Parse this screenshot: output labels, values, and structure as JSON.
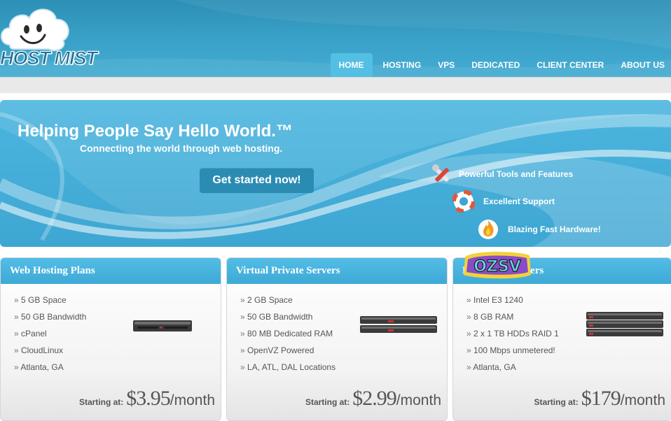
{
  "brand": {
    "logo_text": "HOST MIST"
  },
  "nav": {
    "items": [
      {
        "label": "HOME",
        "active": true
      },
      {
        "label": "HOSTING"
      },
      {
        "label": "VPS"
      },
      {
        "label": "DEDICATED"
      },
      {
        "label": "CLIENT CENTER"
      },
      {
        "label": "ABOUT US"
      }
    ]
  },
  "hero": {
    "title": "Helping People Say Hello World.™",
    "subtitle": "Connecting the world through web hosting.",
    "cta_label": "Get started now!",
    "features": [
      {
        "label": "Powerful Tools and Features",
        "icon": "tools-icon"
      },
      {
        "label": "Excellent Support",
        "icon": "lifebuoy-icon"
      },
      {
        "label": "Blazing Fast Hardware!",
        "icon": "flame-icon"
      }
    ]
  },
  "cards": [
    {
      "title": "Web Hosting Plans",
      "items": [
        "5 GB Space",
        "50 GB Bandwidth",
        "cPanel",
        "CloudLinux",
        "Atlanta, GA"
      ],
      "price_label": "Starting at:",
      "price": "$3.95",
      "unit": "/month"
    },
    {
      "title": "Virtual Private Servers",
      "items": [
        "2 GB Space",
        "50 GB Bandwidth",
        "80 MB Dedicated RAM",
        "OpenVZ Powered",
        "LA, ATL, DAL Locations"
      ],
      "price_label": "Starting at:",
      "price": "$2.99",
      "unit": "/month"
    },
    {
      "title": "Dedicated Servers",
      "items": [
        "Intel E3 1240",
        "8 GB RAM",
        "2 x 1 TB HDDs RAID 1",
        "100 Mbps unmetered!",
        "Atlanta, GA"
      ],
      "price_label": "Starting at:",
      "price": "$179",
      "unit": "/month"
    }
  ],
  "watermark": {
    "text": "OZSV"
  },
  "colors": {
    "header": "#3aa2c8",
    "accent": "#53bfe3",
    "cta": "#2a8cb3",
    "text": "#555555"
  }
}
